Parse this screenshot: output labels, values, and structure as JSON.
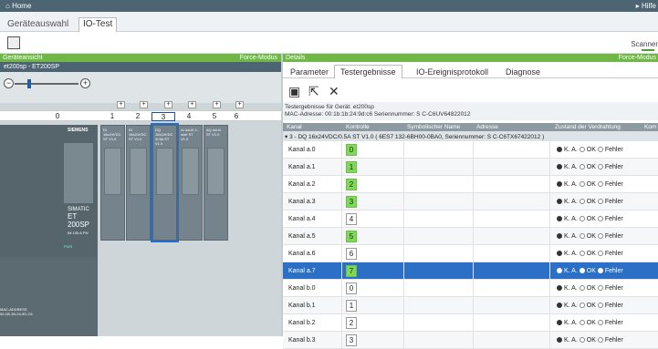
{
  "topbar": {
    "home": "Home",
    "help": "Hilfe"
  },
  "tabs": [
    "Geräteauswahl",
    "IO-Test"
  ],
  "toolbar": {
    "scanner": "Scanner"
  },
  "left": {
    "header": "Geräteansicht",
    "mode": "Force-Modus",
    "device": "et200sp - ET200SP",
    "slots": [
      "0",
      "1",
      "2",
      "3",
      "4",
      "5",
      "6"
    ],
    "cpu": {
      "brand": "SIEMENS",
      "name1": "SIMATIC",
      "name2": "ET 200SP",
      "sub": "IM 155-6 PN",
      "pn": "PWR",
      "mac": "MAC-ADDRESS\n00-1B-1B-24-9D-C6"
    },
    "modules": [
      {
        "lbl": "DI\n16x24VDC\nST V1.0"
      },
      {
        "lbl": "DI\n16x24VDC\nST V1.0"
      },
      {
        "lbl": "DQ\n16x24VDC\n/0.5A ST\nV1.0"
      },
      {
        "lbl": "AI 4xU/I 2-\nwire ST\nV1.0"
      },
      {
        "lbl": "AQ 4xU/I\nST V1.0"
      }
    ]
  },
  "right": {
    "header": "Details",
    "mode": "Force-Modus",
    "tabs": [
      "Parameter",
      "Testergebnisse",
      "IO-Ereignisprotokoll",
      "Diagnose"
    ],
    "info1": "Testergebnisse für Gerät: et200sp",
    "info2": "MAC-Adresse: 00:1b:1b:24:9d:c6 Seriennummer: S C-C6UV64822012",
    "cols": [
      "Kanal",
      "Kontrolle",
      "Symbolischer Name",
      "Adresse",
      "Zustand der Verdrahtung",
      "Kom"
    ],
    "group": "▾ 3 - DQ 16x24VDC/0.5A ST V1.0 ( 6ES7 132-6BH00-0BA0, Seriennummer: S C-C6TX67422012 )",
    "radio_labels": [
      "K. A.",
      "OK",
      "Fehler"
    ],
    "rows": [
      {
        "kanal": "Kanal a.0",
        "val": "0",
        "green": true
      },
      {
        "kanal": "Kanal a.1",
        "val": "1",
        "green": true
      },
      {
        "kanal": "Kanal a.2",
        "val": "2",
        "green": true
      },
      {
        "kanal": "Kanal a.3",
        "val": "3",
        "green": true
      },
      {
        "kanal": "Kanal a.4",
        "val": "4",
        "green": false
      },
      {
        "kanal": "Kanal a.5",
        "val": "5",
        "green": true
      },
      {
        "kanal": "Kanal a.6",
        "val": "6",
        "green": false
      },
      {
        "kanal": "Kanal a.7",
        "val": "7",
        "green": true,
        "selected": true
      },
      {
        "kanal": "Kanal b.0",
        "val": "0",
        "green": false
      },
      {
        "kanal": "Kanal b.1",
        "val": "1",
        "green": false
      },
      {
        "kanal": "Kanal b.2",
        "val": "2",
        "green": false
      },
      {
        "kanal": "Kanal b.3",
        "val": "3",
        "green": false
      }
    ]
  }
}
